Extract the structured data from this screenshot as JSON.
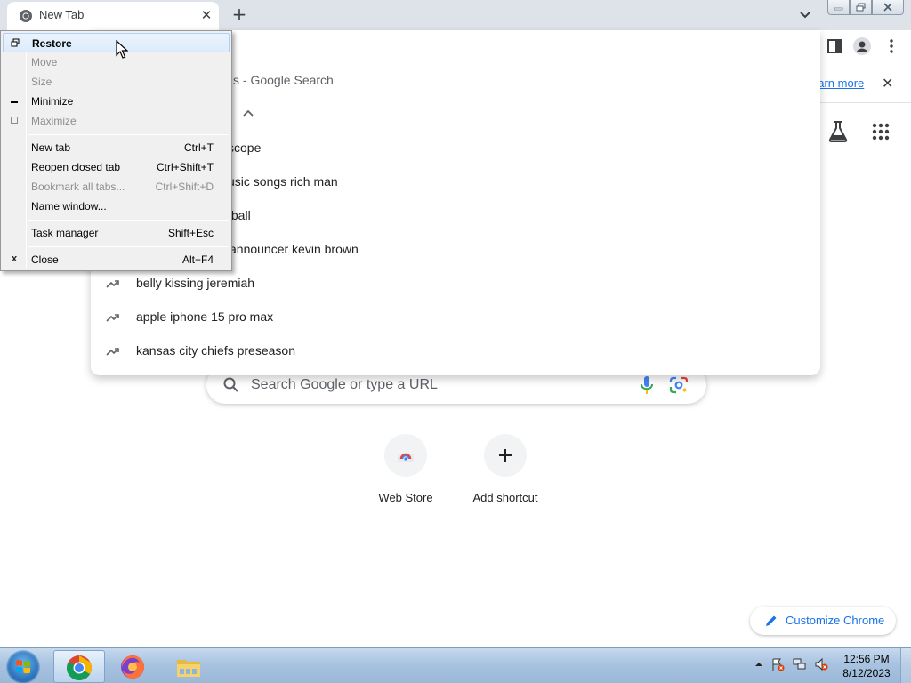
{
  "browser": {
    "tab_title": "New Tab",
    "learn_more": "earn more"
  },
  "omnibox_dropdown": {
    "header": "s - Google Search",
    "suggestions": [
      "scope",
      "usic songs rich man",
      "tball",
      "announcer kevin brown",
      "belly kissing jeremiah",
      "apple iphone 15 pro max",
      "kansas city chiefs preseason"
    ]
  },
  "ntp": {
    "search_placeholder": "Search Google or type a URL",
    "shortcuts": [
      {
        "label": "Web Store"
      },
      {
        "label": "Add shortcut"
      }
    ],
    "customize_label": "Customize Chrome"
  },
  "system_menu": {
    "items": [
      {
        "label": "Restore",
        "shortcut": "",
        "icon": "restore-icon",
        "enabled": true,
        "highlighted": true
      },
      {
        "label": "Move",
        "shortcut": "",
        "icon": "",
        "enabled": false
      },
      {
        "label": "Size",
        "shortcut": "",
        "icon": "",
        "enabled": false
      },
      {
        "label": "Minimize",
        "shortcut": "",
        "icon": "minimize-icon",
        "enabled": true
      },
      {
        "label": "Maximize",
        "shortcut": "",
        "icon": "maximize-icon",
        "enabled": false
      },
      {
        "label": "New tab",
        "shortcut": "Ctrl+T",
        "enabled": true
      },
      {
        "label": "Reopen closed tab",
        "shortcut": "Ctrl+Shift+T",
        "enabled": true
      },
      {
        "label": "Bookmark all tabs...",
        "shortcut": "Ctrl+Shift+D",
        "enabled": false
      },
      {
        "label": "Name window...",
        "shortcut": "",
        "enabled": true
      },
      {
        "label": "Task manager",
        "shortcut": "Shift+Esc",
        "enabled": true
      },
      {
        "label": "Close",
        "shortcut": "Alt+F4",
        "icon": "close-icon",
        "enabled": true
      }
    ]
  },
  "taskbar": {
    "time": "12:56 PM",
    "date": "8/12/2023"
  }
}
